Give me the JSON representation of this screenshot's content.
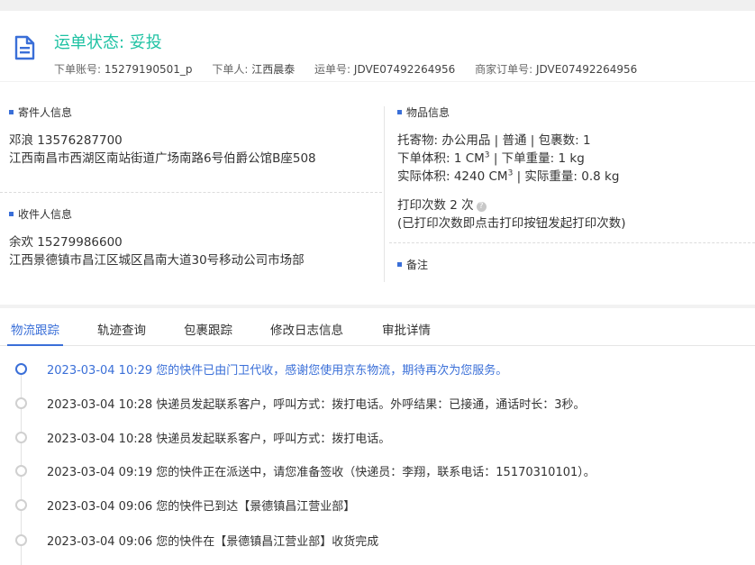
{
  "header": {
    "status_label": "运单状态: 妥投",
    "account_key": "下单账号:",
    "account_value": "15279190501_p",
    "orderer_key": "下单人:",
    "orderer_value": "江西晨泰",
    "waybill_key": "运单号:",
    "waybill_value": "JDVE07492264956",
    "merchant_key": "商家订单号:",
    "merchant_value": "JDVE07492264956"
  },
  "sender": {
    "title": "寄件人信息",
    "name_phone": "邓浪   13576287700",
    "address": "江西南昌市西湖区南站街道广场南路6号伯爵公馆B座508"
  },
  "receiver": {
    "title": "收件人信息",
    "name_phone": "余欢   15279986600",
    "address": "江西景德镇市昌江区城区昌南大道30号移动公司市场部"
  },
  "goods": {
    "title": "物品信息",
    "line1": "托寄物:  办公用品 | 普通  |  包裹数:   1",
    "line2_a": "下单体积:    1 CM",
    "line2_b": "  |  下单重量:    1 kg",
    "line3_a": "实际体积:    4240 CM",
    "line3_b": "  |  实际重量:    0.8 kg",
    "superscript": "3",
    "print_count": "打印次数    2 次",
    "print_help": "?",
    "print_note": "(已打印次数即点击打印按钮发起打印次数)"
  },
  "remarks": {
    "title": "备注"
  },
  "tabs": [
    {
      "label": "物流跟踪"
    },
    {
      "label": "轨迹查询"
    },
    {
      "label": "包裹跟踪"
    },
    {
      "label": "修改日志信息"
    },
    {
      "label": "审批详情"
    }
  ],
  "timeline": [
    {
      "text": "2023-03-04 10:29 您的快件已由门卫代收，感谢您使用京东物流，期待再次为您服务。",
      "active": true
    },
    {
      "text": "2023-03-04 10:28 快递员发起联系客户，呼叫方式：拨打电话。外呼结果：已接通，通话时长：3秒。",
      "active": false
    },
    {
      "text": "2023-03-04 10:28 快递员发起联系客户，呼叫方式：拨打电话。",
      "active": false
    },
    {
      "text": "2023-03-04 09:19 您的快件正在派送中，请您准备签收（快递员：李翔，联系电话：15170310101）。",
      "active": false
    },
    {
      "text": "2023-03-04 09:06 您的快件已到达【景德镇昌江营业部】",
      "active": false
    },
    {
      "text": "2023-03-04 09:06 您的快件在【景德镇昌江营业部】收货完成",
      "active": false
    }
  ],
  "colors": {
    "accent": "#3a6fd8",
    "status": "#1ec2a3"
  }
}
